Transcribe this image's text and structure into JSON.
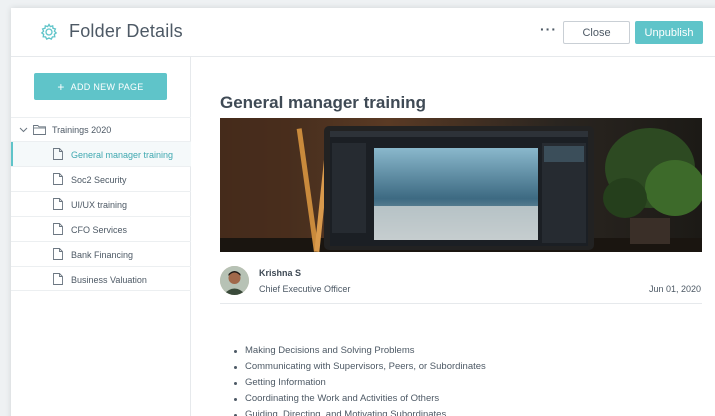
{
  "header": {
    "title": "Folder Details",
    "icon": "gear-icon",
    "more_label": "···",
    "close_label": "Close",
    "unpublish_label": "Unpublish"
  },
  "sidebar": {
    "add_page_label": "ADD NEW PAGE",
    "folder": {
      "label": "Trainings 2020",
      "expanded": true
    },
    "items": [
      {
        "label": "General manager training",
        "active": true
      },
      {
        "label": "Soc2 Security",
        "active": false
      },
      {
        "label": "UI/UX training",
        "active": false
      },
      {
        "label": "CFO Services",
        "active": false
      },
      {
        "label": "Bank Financing",
        "active": false
      },
      {
        "label": "Business Valuation",
        "active": false
      }
    ]
  },
  "main": {
    "title": "General manager training",
    "author": {
      "name": "Krishna S",
      "role": "Chief Executive Officer"
    },
    "date": "Jun 01, 2020",
    "bullets": [
      "Making Decisions and Solving Problems",
      "Communicating with Supervisors, Peers, or Subordinates",
      "Getting Information",
      "Coordinating the Work and Activities of Others",
      "Guiding, Directing, and Motivating Subordinates"
    ]
  },
  "colors": {
    "accent": "#5fc4c9",
    "text": "#4d5965",
    "border": "#e6e9ec"
  }
}
